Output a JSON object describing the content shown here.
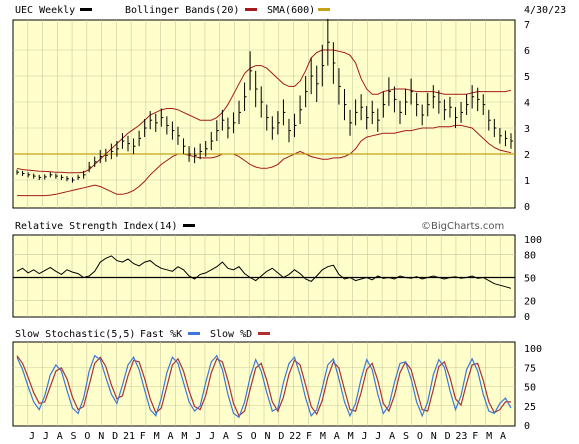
{
  "header": {
    "symbol_label": "UEC Weekly",
    "bb_label": "Bollinger Bands(20)",
    "sma_label": "SMA(600)",
    "date": "4/30/23"
  },
  "watermark": "©BigCharts.com",
  "colors": {
    "background": "#ffffcc",
    "grid": "#c8c8a0",
    "price": "#000000",
    "bollinger": "#a31a1a",
    "sma": "#c8a018",
    "fast_k": "#3c78d8",
    "slow_d": "#b03030",
    "rsi": "#000000"
  },
  "chart_data": [
    {
      "type": "line",
      "name": "price",
      "title": "UEC Weekly",
      "ylim": [
        0,
        7
      ],
      "y_ticks": [
        "0",
        "1",
        "2",
        "3",
        "4",
        "5",
        "6",
        "7"
      ],
      "grid": true,
      "series": [
        {
          "name": "UEC Weekly",
          "style": "ohlc-bars",
          "values": [
            1.3,
            1.25,
            1.2,
            1.15,
            1.1,
            1.12,
            1.2,
            1.15,
            1.1,
            1.05,
            1.0,
            1.1,
            1.2,
            1.5,
            1.7,
            1.9,
            1.95,
            2.1,
            2.2,
            2.5,
            2.4,
            2.3,
            2.6,
            3.0,
            3.3,
            3.2,
            3.4,
            3.1,
            2.9,
            2.7,
            2.3,
            2.0,
            1.95,
            2.1,
            2.2,
            2.5,
            2.9,
            3.3,
            3.0,
            3.2,
            3.6,
            4.2,
            5.2,
            4.5,
            4.0,
            3.4,
            3.0,
            3.2,
            3.6,
            2.9,
            3.1,
            3.7,
            4.4,
            5.0,
            4.7,
            5.4,
            6.3,
            5.5,
            4.6,
            3.9,
            3.2,
            3.6,
            3.8,
            3.4,
            3.6,
            3.3,
            3.9,
            4.4,
            4.1,
            3.6,
            4.0,
            4.4,
            3.9,
            3.5,
            3.9,
            4.2,
            4.0,
            3.7,
            3.8,
            3.4,
            3.6,
            3.9,
            4.2,
            4.1,
            3.9,
            3.3,
            3.0,
            2.7,
            2.6,
            2.5
          ],
          "spread": [
            0.1,
            0.1,
            0.1,
            0.1,
            0.1,
            0.1,
            0.1,
            0.1,
            0.1,
            0.1,
            0.1,
            0.1,
            0.15,
            0.2,
            0.2,
            0.25,
            0.25,
            0.3,
            0.3,
            0.3,
            0.3,
            0.3,
            0.3,
            0.35,
            0.35,
            0.35,
            0.35,
            0.35,
            0.35,
            0.35,
            0.3,
            0.3,
            0.3,
            0.3,
            0.3,
            0.35,
            0.4,
            0.4,
            0.4,
            0.4,
            0.45,
            0.55,
            0.75,
            0.7,
            0.6,
            0.5,
            0.45,
            0.45,
            0.5,
            0.45,
            0.45,
            0.55,
            0.6,
            0.7,
            0.7,
            0.8,
            0.9,
            0.8,
            0.7,
            0.6,
            0.5,
            0.5,
            0.5,
            0.45,
            0.45,
            0.45,
            0.5,
            0.55,
            0.5,
            0.45,
            0.5,
            0.5,
            0.45,
            0.4,
            0.45,
            0.45,
            0.45,
            0.4,
            0.4,
            0.4,
            0.4,
            0.4,
            0.45,
            0.45,
            0.4,
            0.4,
            0.35,
            0.3,
            0.3,
            0.3
          ]
        },
        {
          "name": "Bollinger Bands(20) upper",
          "values": [
            1.45,
            1.4,
            1.38,
            1.36,
            1.34,
            1.33,
            1.32,
            1.3,
            1.3,
            1.28,
            1.28,
            1.28,
            1.3,
            1.4,
            1.6,
            1.8,
            2.0,
            2.2,
            2.4,
            2.6,
            2.8,
            2.95,
            3.1,
            3.3,
            3.5,
            3.6,
            3.7,
            3.75,
            3.75,
            3.7,
            3.6,
            3.5,
            3.4,
            3.3,
            3.3,
            3.3,
            3.4,
            3.6,
            3.9,
            4.3,
            4.7,
            5.1,
            5.3,
            5.4,
            5.4,
            5.3,
            5.1,
            4.9,
            4.7,
            4.6,
            4.6,
            4.8,
            5.2,
            5.7,
            5.9,
            6.0,
            6.0,
            6.0,
            5.95,
            5.9,
            5.8,
            5.5,
            4.9,
            4.5,
            4.3,
            4.3,
            4.4,
            4.45,
            4.5,
            4.5,
            4.5,
            4.45,
            4.4,
            4.4,
            4.4,
            4.4,
            4.35,
            4.3,
            4.3,
            4.3,
            4.3,
            4.3,
            4.35,
            4.4,
            4.4,
            4.4,
            4.4,
            4.4,
            4.4,
            4.45
          ]
        },
        {
          "name": "Bollinger Bands(20) lower",
          "values": [
            0.4,
            0.4,
            0.4,
            0.4,
            0.4,
            0.4,
            0.42,
            0.45,
            0.5,
            0.55,
            0.6,
            0.65,
            0.7,
            0.75,
            0.8,
            0.75,
            0.65,
            0.55,
            0.45,
            0.45,
            0.5,
            0.6,
            0.75,
            0.95,
            1.2,
            1.4,
            1.6,
            1.75,
            1.9,
            2.0,
            2.0,
            1.95,
            1.9,
            1.85,
            1.85,
            1.85,
            1.9,
            2.0,
            2.0,
            2.0,
            1.9,
            1.75,
            1.6,
            1.5,
            1.45,
            1.45,
            1.5,
            1.6,
            1.8,
            1.9,
            2.0,
            2.1,
            2.0,
            1.9,
            1.85,
            1.8,
            1.8,
            1.85,
            1.85,
            1.9,
            2.0,
            2.2,
            2.5,
            2.65,
            2.7,
            2.75,
            2.8,
            2.8,
            2.8,
            2.85,
            2.9,
            2.9,
            2.95,
            3.0,
            3.0,
            3.0,
            3.05,
            3.05,
            3.05,
            3.1,
            3.1,
            3.05,
            3.0,
            2.8,
            2.6,
            2.4,
            2.25,
            2.15,
            2.1,
            2.05
          ]
        },
        {
          "name": "SMA(600)",
          "values": [
            2.0,
            2.0
          ]
        }
      ]
    },
    {
      "type": "line",
      "name": "rsi",
      "title": "Relative Strength Index(14)",
      "ylim": [
        0,
        100
      ],
      "y_ticks": [
        "0",
        "20",
        "50",
        "80",
        "100"
      ],
      "reference_line": 50,
      "grid": true,
      "series": [
        {
          "name": "Relative Strength Index(14)",
          "values": [
            58,
            62,
            56,
            60,
            55,
            59,
            63,
            58,
            54,
            60,
            57,
            55,
            50,
            52,
            58,
            70,
            75,
            78,
            72,
            70,
            74,
            68,
            65,
            70,
            72,
            66,
            62,
            60,
            58,
            64,
            60,
            52,
            48,
            54,
            56,
            60,
            64,
            70,
            62,
            60,
            64,
            55,
            50,
            46,
            52,
            58,
            62,
            56,
            50,
            54,
            60,
            55,
            48,
            45,
            52,
            60,
            64,
            66,
            54,
            48,
            50,
            46,
            48,
            50,
            47,
            52,
            49,
            50,
            48,
            52,
            50,
            49,
            51,
            48,
            50,
            52,
            50,
            48,
            50,
            51,
            49,
            50,
            52,
            49,
            50,
            46,
            42,
            40,
            38,
            36
          ]
        }
      ]
    },
    {
      "type": "line",
      "name": "stochastic",
      "title": "Slow Stochastic(5,5)",
      "ylim": [
        0,
        100
      ],
      "y_ticks": [
        "0",
        "25",
        "50",
        "75",
        "100"
      ],
      "grid": true,
      "x_ticks": [
        "J",
        "J",
        "A",
        "S",
        "O",
        "N",
        "D",
        "21",
        "F",
        "M",
        "A",
        "M",
        "J",
        "J",
        "A",
        "S",
        "O",
        "N",
        "D",
        "22",
        "F",
        "M",
        "A",
        "M",
        "J",
        "J",
        "A",
        "S",
        "O",
        "N",
        "D",
        "23",
        "F",
        "M",
        "A"
      ],
      "series": [
        {
          "name": "Fast %K",
          "values": [
            88,
            72,
            50,
            30,
            20,
            38,
            65,
            78,
            70,
            45,
            22,
            15,
            35,
            70,
            90,
            85,
            62,
            40,
            28,
            52,
            78,
            88,
            72,
            45,
            20,
            12,
            35,
            68,
            88,
            80,
            55,
            30,
            18,
            25,
            55,
            82,
            90,
            72,
            40,
            15,
            10,
            30,
            62,
            85,
            70,
            42,
            18,
            22,
            55,
            80,
            88,
            65,
            35,
            12,
            20,
            48,
            78,
            86,
            60,
            30,
            12,
            28,
            60,
            85,
            72,
            40,
            15,
            25,
            55,
            80,
            82,
            60,
            30,
            12,
            30,
            65,
            85,
            75,
            45,
            20,
            38,
            72,
            86,
            70,
            40,
            18,
            15,
            28,
            35,
            22
          ]
        },
        {
          "name": "Slow %D",
          "values": [
            90,
            80,
            62,
            42,
            28,
            30,
            50,
            70,
            74,
            60,
            36,
            20,
            24,
            52,
            80,
            88,
            76,
            52,
            34,
            38,
            64,
            84,
            82,
            60,
            34,
            16,
            22,
            50,
            78,
            86,
            70,
            44,
            24,
            20,
            38,
            68,
            86,
            82,
            58,
            28,
            12,
            18,
            46,
            74,
            80,
            58,
            30,
            18,
            36,
            66,
            84,
            78,
            52,
            24,
            14,
            32,
            62,
            82,
            74,
            46,
            20,
            18,
            42,
            72,
            80,
            58,
            28,
            18,
            38,
            68,
            82,
            72,
            46,
            20,
            18,
            46,
            76,
            82,
            62,
            34,
            26,
            54,
            78,
            80,
            58,
            30,
            16,
            20,
            30,
            30
          ]
        }
      ]
    }
  ]
}
